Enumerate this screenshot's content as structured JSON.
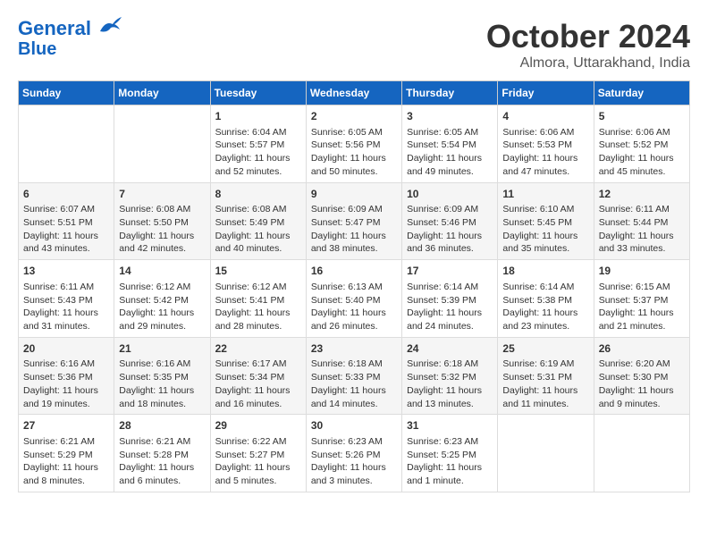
{
  "header": {
    "logo_line1": "General",
    "logo_line2": "Blue",
    "month_title": "October 2024",
    "location": "Almora, Uttarakhand, India"
  },
  "weekdays": [
    "Sunday",
    "Monday",
    "Tuesday",
    "Wednesday",
    "Thursday",
    "Friday",
    "Saturday"
  ],
  "weeks": [
    [
      {
        "day": "",
        "info": ""
      },
      {
        "day": "",
        "info": ""
      },
      {
        "day": "1",
        "info": "Sunrise: 6:04 AM\nSunset: 5:57 PM\nDaylight: 11 hours and 52 minutes."
      },
      {
        "day": "2",
        "info": "Sunrise: 6:05 AM\nSunset: 5:56 PM\nDaylight: 11 hours and 50 minutes."
      },
      {
        "day": "3",
        "info": "Sunrise: 6:05 AM\nSunset: 5:54 PM\nDaylight: 11 hours and 49 minutes."
      },
      {
        "day": "4",
        "info": "Sunrise: 6:06 AM\nSunset: 5:53 PM\nDaylight: 11 hours and 47 minutes."
      },
      {
        "day": "5",
        "info": "Sunrise: 6:06 AM\nSunset: 5:52 PM\nDaylight: 11 hours and 45 minutes."
      }
    ],
    [
      {
        "day": "6",
        "info": "Sunrise: 6:07 AM\nSunset: 5:51 PM\nDaylight: 11 hours and 43 minutes."
      },
      {
        "day": "7",
        "info": "Sunrise: 6:08 AM\nSunset: 5:50 PM\nDaylight: 11 hours and 42 minutes."
      },
      {
        "day": "8",
        "info": "Sunrise: 6:08 AM\nSunset: 5:49 PM\nDaylight: 11 hours and 40 minutes."
      },
      {
        "day": "9",
        "info": "Sunrise: 6:09 AM\nSunset: 5:47 PM\nDaylight: 11 hours and 38 minutes."
      },
      {
        "day": "10",
        "info": "Sunrise: 6:09 AM\nSunset: 5:46 PM\nDaylight: 11 hours and 36 minutes."
      },
      {
        "day": "11",
        "info": "Sunrise: 6:10 AM\nSunset: 5:45 PM\nDaylight: 11 hours and 35 minutes."
      },
      {
        "day": "12",
        "info": "Sunrise: 6:11 AM\nSunset: 5:44 PM\nDaylight: 11 hours and 33 minutes."
      }
    ],
    [
      {
        "day": "13",
        "info": "Sunrise: 6:11 AM\nSunset: 5:43 PM\nDaylight: 11 hours and 31 minutes."
      },
      {
        "day": "14",
        "info": "Sunrise: 6:12 AM\nSunset: 5:42 PM\nDaylight: 11 hours and 29 minutes."
      },
      {
        "day": "15",
        "info": "Sunrise: 6:12 AM\nSunset: 5:41 PM\nDaylight: 11 hours and 28 minutes."
      },
      {
        "day": "16",
        "info": "Sunrise: 6:13 AM\nSunset: 5:40 PM\nDaylight: 11 hours and 26 minutes."
      },
      {
        "day": "17",
        "info": "Sunrise: 6:14 AM\nSunset: 5:39 PM\nDaylight: 11 hours and 24 minutes."
      },
      {
        "day": "18",
        "info": "Sunrise: 6:14 AM\nSunset: 5:38 PM\nDaylight: 11 hours and 23 minutes."
      },
      {
        "day": "19",
        "info": "Sunrise: 6:15 AM\nSunset: 5:37 PM\nDaylight: 11 hours and 21 minutes."
      }
    ],
    [
      {
        "day": "20",
        "info": "Sunrise: 6:16 AM\nSunset: 5:36 PM\nDaylight: 11 hours and 19 minutes."
      },
      {
        "day": "21",
        "info": "Sunrise: 6:16 AM\nSunset: 5:35 PM\nDaylight: 11 hours and 18 minutes."
      },
      {
        "day": "22",
        "info": "Sunrise: 6:17 AM\nSunset: 5:34 PM\nDaylight: 11 hours and 16 minutes."
      },
      {
        "day": "23",
        "info": "Sunrise: 6:18 AM\nSunset: 5:33 PM\nDaylight: 11 hours and 14 minutes."
      },
      {
        "day": "24",
        "info": "Sunrise: 6:18 AM\nSunset: 5:32 PM\nDaylight: 11 hours and 13 minutes."
      },
      {
        "day": "25",
        "info": "Sunrise: 6:19 AM\nSunset: 5:31 PM\nDaylight: 11 hours and 11 minutes."
      },
      {
        "day": "26",
        "info": "Sunrise: 6:20 AM\nSunset: 5:30 PM\nDaylight: 11 hours and 9 minutes."
      }
    ],
    [
      {
        "day": "27",
        "info": "Sunrise: 6:21 AM\nSunset: 5:29 PM\nDaylight: 11 hours and 8 minutes."
      },
      {
        "day": "28",
        "info": "Sunrise: 6:21 AM\nSunset: 5:28 PM\nDaylight: 11 hours and 6 minutes."
      },
      {
        "day": "29",
        "info": "Sunrise: 6:22 AM\nSunset: 5:27 PM\nDaylight: 11 hours and 5 minutes."
      },
      {
        "day": "30",
        "info": "Sunrise: 6:23 AM\nSunset: 5:26 PM\nDaylight: 11 hours and 3 minutes."
      },
      {
        "day": "31",
        "info": "Sunrise: 6:23 AM\nSunset: 5:25 PM\nDaylight: 11 hours and 1 minute."
      },
      {
        "day": "",
        "info": ""
      },
      {
        "day": "",
        "info": ""
      }
    ]
  ]
}
